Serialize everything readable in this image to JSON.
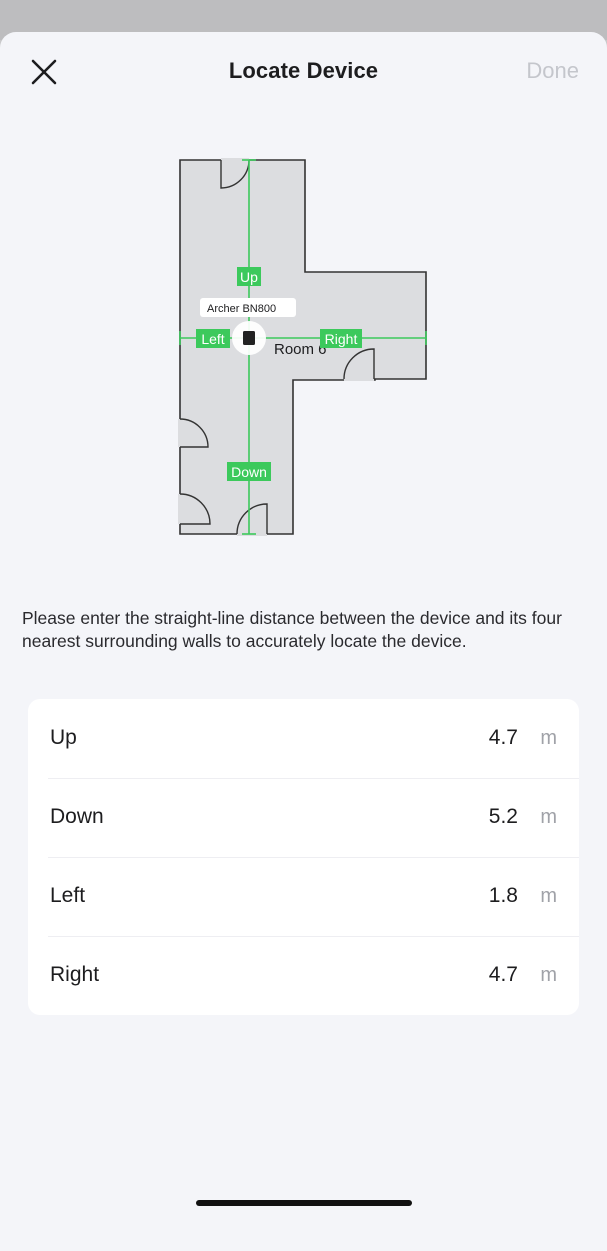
{
  "header": {
    "title": "Locate Device",
    "done_label": "Done"
  },
  "floorplan": {
    "device_label": "Archer BN800",
    "room_label": "Room 6",
    "direction_tags": {
      "up": "Up",
      "down": "Down",
      "left": "Left",
      "right": "Right"
    }
  },
  "description": "Please enter the straight-line distance between the device and its four nearest surrounding walls to accurately locate the device.",
  "distances": [
    {
      "label": "Up",
      "value": "4.7",
      "unit": "m"
    },
    {
      "label": "Down",
      "value": "5.2",
      "unit": "m"
    },
    {
      "label": "Left",
      "value": "1.8",
      "unit": "m"
    },
    {
      "label": "Right",
      "value": "4.7",
      "unit": "m"
    }
  ],
  "colors": {
    "accent_green": "#3cc95c",
    "room_fill": "#dcdde0",
    "wall": "#333333",
    "done_disabled": "#c4c6cc"
  },
  "icons": {
    "close": "close-icon",
    "device": "router-icon"
  }
}
